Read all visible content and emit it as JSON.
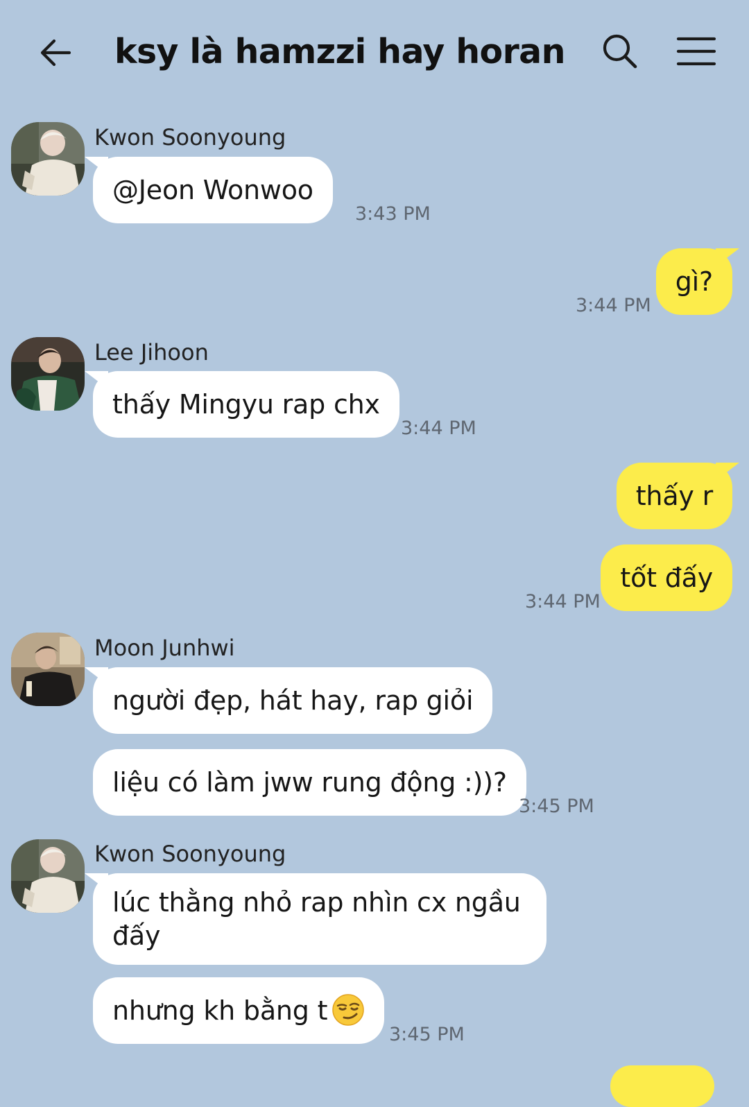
{
  "header": {
    "title": "ksy là hamzzi hay horangie..."
  },
  "icons": {
    "back": "arrow-left-icon",
    "search": "search-icon",
    "menu": "hamburger-menu-icon"
  },
  "colors": {
    "background": "#b2c7dd",
    "incoming_bubble": "#ffffff",
    "outgoing_bubble": "#fcec4b"
  },
  "messages": [
    {
      "sender": "Kwon Soonyoung",
      "bubbles": [
        "@Jeon Wonwoo"
      ],
      "time": "3:43 PM"
    },
    {
      "sender": "me",
      "bubbles": [
        "gì?"
      ],
      "time": "3:44 PM"
    },
    {
      "sender": "Lee Jihoon",
      "bubbles": [
        "thấy Mingyu rap chx"
      ],
      "time": "3:44 PM"
    },
    {
      "sender": "me",
      "bubbles": [
        "thấy r",
        "tốt đấy"
      ],
      "time": "3:44 PM"
    },
    {
      "sender": "Moon Junhwi",
      "bubbles": [
        "người đẹp, hát hay, rap giỏi",
        "liệu có làm jww rung động :))?"
      ],
      "time": "3:45 PM"
    },
    {
      "sender": "Kwon Soonyoung",
      "bubbles": [
        "lúc thằng nhỏ rap nhìn cx ngầu đấy",
        "nhưng kh bằng t"
      ],
      "emoji": "smirking-face-emoji",
      "time": "3:45 PM"
    }
  ]
}
